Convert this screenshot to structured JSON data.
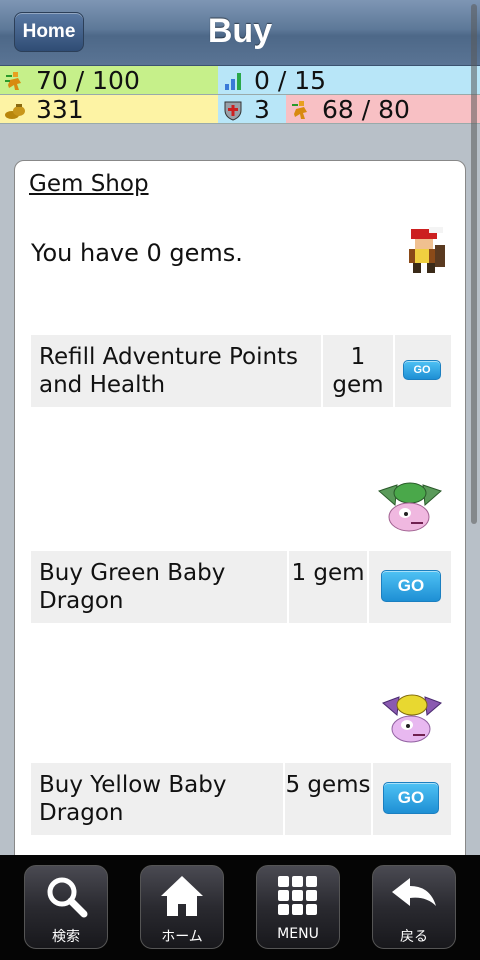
{
  "header": {
    "home_label": "Home",
    "title": "Buy"
  },
  "stats": {
    "adventure": "70 / 100",
    "level_progress": "0 / 15",
    "gold": "331",
    "defense": "3",
    "health": "68 / 80"
  },
  "shop": {
    "title": "Gem Shop",
    "gem_status": "You have 0 gems.",
    "items": [
      {
        "label": "Refill Adventure Points and Health",
        "price": "1 gem",
        "go_label": "GO"
      },
      {
        "label": "Buy Green Baby Dragon",
        "price": "1 gem",
        "go_label": "GO"
      },
      {
        "label": "Buy Yellow Baby Dragon",
        "price": "5 gems",
        "go_label": "GO"
      }
    ]
  },
  "bottom_nav": {
    "search": "検索",
    "home": "ホーム",
    "menu": "MENU",
    "back": "戻る"
  },
  "colors": {
    "go_button": "#2aa0e0",
    "header": "#5d7898"
  }
}
